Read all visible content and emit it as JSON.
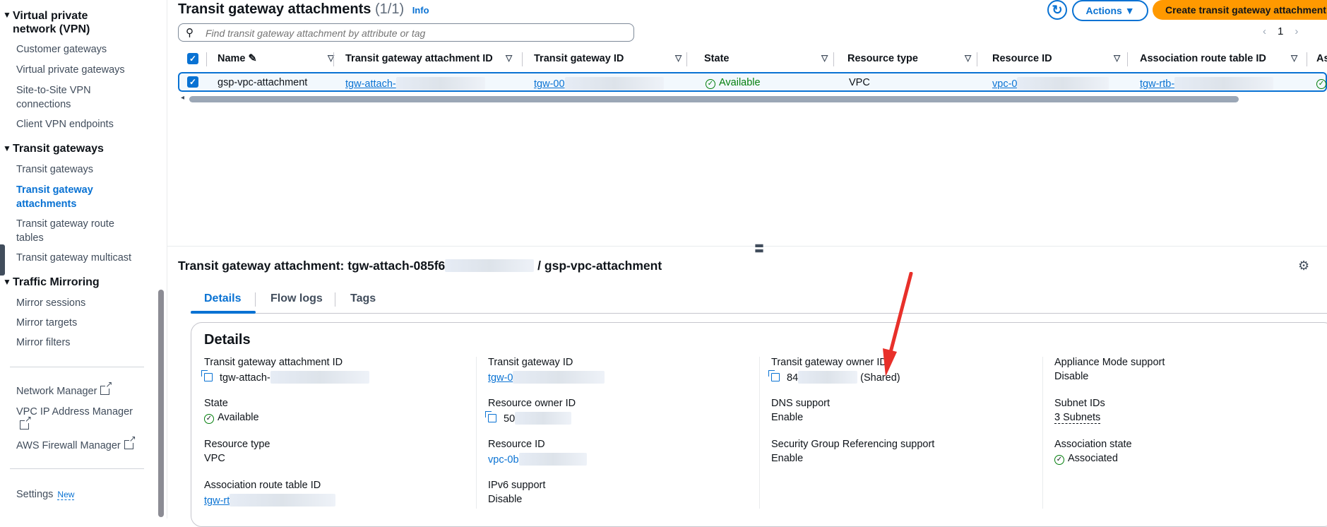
{
  "sidebar": {
    "vpn_section": "Virtual private network (VPN)",
    "vpn_items": [
      "Customer gateways",
      "Virtual private gateways",
      "Site-to-Site VPN connections",
      "Client VPN endpoints"
    ],
    "tgw_section": "Transit gateways",
    "tgw_items": [
      "Transit gateways",
      "Transit gateway attachments",
      "Transit gateway route tables",
      "Transit gateway multicast"
    ],
    "mirror_section": "Traffic Mirroring",
    "mirror_items": [
      "Mirror sessions",
      "Mirror targets",
      "Mirror filters"
    ],
    "links": [
      "Network Manager",
      "VPC IP Address Manager",
      "AWS Firewall Manager"
    ],
    "settings": "Settings",
    "new_badge": "New",
    "active_item": "Transit gateway attachments"
  },
  "list": {
    "title": "Transit gateway attachments",
    "count": "(1/1)",
    "info": "Info",
    "actions": "Actions",
    "create": "Create transit gateway attachment",
    "search_placeholder": "Find transit gateway attachment by attribute or tag",
    "page": "1",
    "columns": [
      "Name",
      "Transit gateway attachment ID",
      "Transit gateway ID",
      "State",
      "Resource type",
      "Resource ID",
      "Association route table ID",
      "As"
    ],
    "row": {
      "name": "gsp-vpc-attachment",
      "attachment_id": "tgw-attach-",
      "tgw_id": "tgw-00",
      "state": "Available",
      "resource_type": "VPC",
      "resource_id": "vpc-0",
      "route_table": "tgw-rtb-"
    }
  },
  "detail": {
    "title_prefix": "Transit gateway attachment: tgw-attach-085f6",
    "title_suffix": "/ gsp-vpc-attachment",
    "tabs": [
      "Details",
      "Flow logs",
      "Tags"
    ],
    "section": "Details",
    "fields": {
      "attachment_id_label": "Transit gateway attachment ID",
      "attachment_id": "tgw-attach-",
      "tgw_id_label": "Transit gateway ID",
      "tgw_id": "tgw-0",
      "owner_label": "Transit gateway owner ID",
      "owner": "84",
      "owner_shared": "(Shared)",
      "appliance_label": "Appliance Mode support",
      "appliance": "Disable",
      "state_label": "State",
      "state": "Available",
      "resource_owner_label": "Resource owner ID",
      "resource_owner": "50",
      "dns_label": "DNS support",
      "dns": "Enable",
      "subnets_label": "Subnet IDs",
      "subnets": "3 Subnets",
      "resource_type_label": "Resource type",
      "resource_type": "VPC",
      "resource_id_label": "Resource ID",
      "resource_id": "vpc-0b",
      "sg_label": "Security Group Referencing support",
      "sg": "Enable",
      "assoc_state_label": "Association state",
      "assoc_state": "Associated",
      "route_table_label": "Association route table ID",
      "route_table": "tgw-rt",
      "ipv6_label": "IPv6 support",
      "ipv6": "Disable"
    }
  },
  "colors": {
    "link": "#0972d3",
    "success": "#037f0c",
    "primary_button": "#ff9900",
    "annotation_arrow": "#e8302a"
  }
}
